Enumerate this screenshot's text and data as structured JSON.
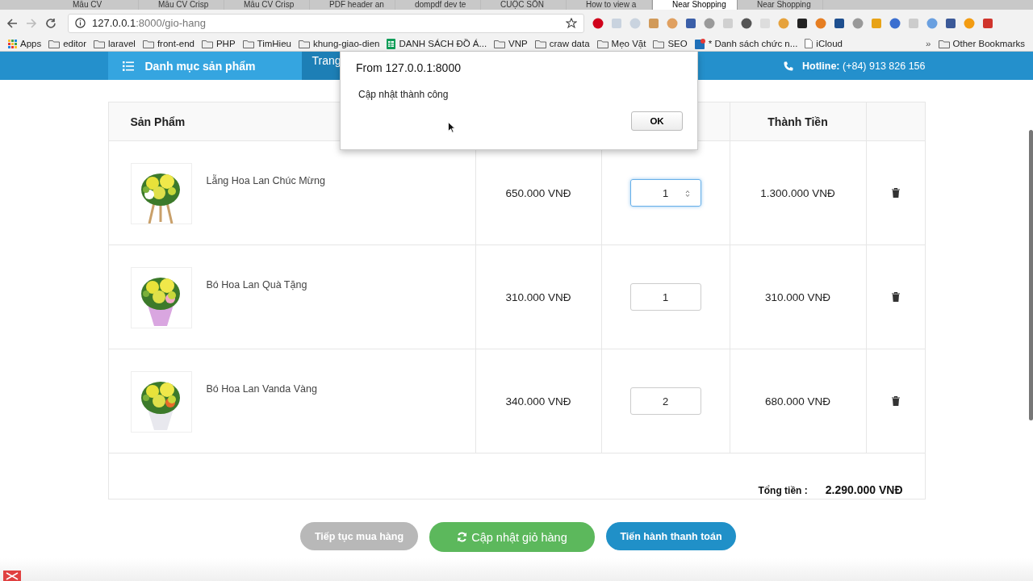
{
  "browser": {
    "tabs": [
      {
        "title": "Mẫu CV",
        "selected": false
      },
      {
        "title": "Mẫu CV Crisp",
        "selected": false
      },
      {
        "title": "Mẫu CV Crisp",
        "selected": false
      },
      {
        "title": "PDF header an",
        "selected": false
      },
      {
        "title": "dompdf dev te",
        "selected": false
      },
      {
        "title": "CUỘC SỐN",
        "selected": false
      },
      {
        "title": "How to view a",
        "selected": false
      },
      {
        "title": "Near Shopping",
        "selected": true
      },
      {
        "title": "Near Shopping",
        "selected": false
      }
    ],
    "address": {
      "host": "127.0.0.1",
      "path": ":8000/gio-hang"
    },
    "bookmarks": [
      {
        "label": "Apps",
        "kind": "apps"
      },
      {
        "label": "editor",
        "kind": "folder"
      },
      {
        "label": "laravel",
        "kind": "folder"
      },
      {
        "label": "front-end",
        "kind": "folder"
      },
      {
        "label": "PHP",
        "kind": "folder"
      },
      {
        "label": "TimHieu",
        "kind": "folder"
      },
      {
        "label": "khung-giao-dien",
        "kind": "folder"
      },
      {
        "label": "DANH SÁCH ĐỒ Á...",
        "kind": "sheet"
      },
      {
        "label": "VNP",
        "kind": "folder"
      },
      {
        "label": "craw data",
        "kind": "folder"
      },
      {
        "label": "Mẹo Vặt",
        "kind": "folder"
      },
      {
        "label": "SEO",
        "kind": "folder"
      },
      {
        "label": "* Danh sách chức n...",
        "kind": "app"
      },
      {
        "label": "iCloud",
        "kind": "page"
      }
    ],
    "overflow": "»",
    "other_bookmarks": "Other Bookmarks"
  },
  "header": {
    "category": "Danh mục sản phẩm",
    "nav": "Trang",
    "hotline": "**Hotline:** (+84) 913 826 156"
  },
  "cart": {
    "product_header": "Sản Phẩm",
    "total_header": "Thành Tiền",
    "rows": [
      {
        "name": "Lẵng Hoa Lan Chúc Mừng",
        "price": "650.000 VNĐ",
        "quantity": "1",
        "total": "1.300.000 VNĐ",
        "focused": true
      },
      {
        "name": "Bó Hoa Lan Quà Tặng",
        "price": "310.000 VNĐ",
        "quantity": "1",
        "total": "310.000 VNĐ",
        "focused": false
      },
      {
        "name": "Bó Hoa Lan Vanda Vàng",
        "price": "340.000 VNĐ",
        "quantity": "2",
        "total": "680.000 VNĐ",
        "focused": false
      }
    ],
    "total_label": "Tổng tiền :",
    "total": "2.290.000 VNĐ"
  },
  "buttons": [
    {
      "label": "Tiếp tục mua hàng",
      "kind": "continue"
    },
    {
      "label": "Cập nhật giỏ hàng",
      "kind": "update"
    },
    {
      "label": "Tiến hành thanh toán",
      "kind": "checkout"
    }
  ],
  "dialog": {
    "title": "From 127.0.0.1:8000",
    "message": "Cập nhật thành công",
    "button": "OK"
  }
}
